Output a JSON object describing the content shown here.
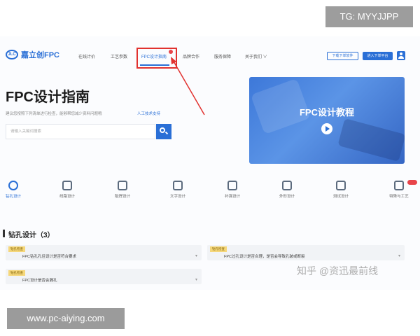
{
  "watermarks": {
    "tg": "TG: MYYJJPP",
    "site": "www.pc-aiying.com",
    "zhihu": "知乎 @资迅最前线"
  },
  "nav": {
    "logo_text": "嘉立创FPC",
    "items": [
      {
        "label": "在线计价"
      },
      {
        "label": "工艺参数"
      },
      {
        "label": "FPC设计指南"
      },
      {
        "label": "品牌合作"
      },
      {
        "label": "服务保障"
      },
      {
        "label": "关于我们 ∨"
      }
    ],
    "active_item": "FPC设计指南",
    "outline_button": "下载下单软件",
    "primary_button": "进入下单平台"
  },
  "hero": {
    "title": "FPC设计指南",
    "subtitle": "建议您按照下列清单进行检查，能够帮您减少资料问题哦",
    "link": "人工技术支持",
    "search_placeholder": "请输入关键词搜索"
  },
  "video": {
    "title": "FPC设计教程"
  },
  "categories": [
    {
      "label": "钻孔设计",
      "icon": "drill-icon",
      "active": true
    },
    {
      "label": "线路设计",
      "icon": "circuit-icon",
      "active": false
    },
    {
      "label": "阻焊设计",
      "icon": "solder-mask-icon",
      "active": false
    },
    {
      "label": "文字设计",
      "icon": "text-icon",
      "active": false
    },
    {
      "label": "补强设计",
      "icon": "stiffener-icon",
      "active": false
    },
    {
      "label": "外形设计",
      "icon": "outline-icon",
      "active": false
    },
    {
      "label": "测试设计",
      "icon": "test-icon",
      "active": false
    },
    {
      "label": "特殊与工艺",
      "icon": "special-process-icon",
      "active": false
    }
  ],
  "section": {
    "title": "钻孔设计（3）",
    "cards": [
      {
        "tag": "钻孔检查",
        "text": "FPC钻孔孔径设计是否符合要求"
      },
      {
        "tag": "钻孔检查",
        "text": "FPC过孔设计是否合理，是否会导致孔破或断裂"
      },
      {
        "tag": "钻孔检查",
        "text": "FPC设计是否会漏孔"
      }
    ]
  },
  "colors": {
    "accent": "#2a6fd6",
    "highlight_box": "#e1322f",
    "tag_bg": "#f5d77a"
  }
}
